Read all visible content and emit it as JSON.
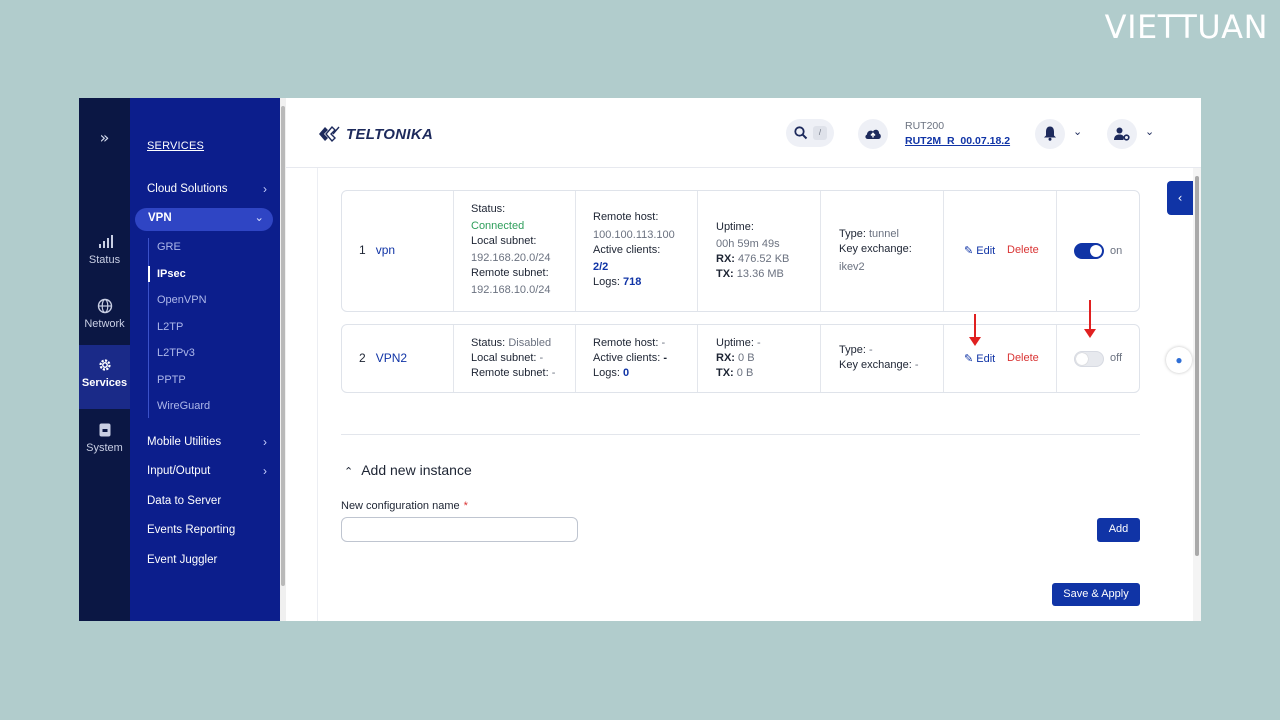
{
  "watermark": "VIETTUAN",
  "rail": {
    "toggle_icon": "double-chevron-right-icon",
    "items": [
      {
        "label": "Status",
        "icon": "signal-bars-icon"
      },
      {
        "label": "Network",
        "icon": "globe-icon"
      },
      {
        "label": "Services",
        "icon": "gear-icon",
        "active": true
      },
      {
        "label": "System",
        "icon": "system-icon"
      }
    ]
  },
  "sidebar": {
    "title": "SERVICES",
    "top_items": [
      "Cloud Solutions"
    ],
    "vpn_label": "VPN",
    "vpn_sub": [
      "GRE",
      "IPsec",
      "OpenVPN",
      "L2TP",
      "L2TPv3",
      "PPTP",
      "WireGuard"
    ],
    "vpn_active": "IPsec",
    "bottom_items": [
      "Mobile Utilities",
      "Input/Output",
      "Data to Server",
      "Events Reporting",
      "Event Juggler"
    ]
  },
  "header": {
    "logo_text": "TELTONIKA",
    "search_key": "/",
    "device_model": "RUT200",
    "firmware": "RUT2M_R_00.07.18.2"
  },
  "instances": [
    {
      "index": "1",
      "name": "vpn",
      "status_label": "Status:",
      "status": "Connected",
      "local_subnet_label": "Local subnet:",
      "local_subnet": "192.168.20.0/24",
      "remote_subnet_label": "Remote subnet:",
      "remote_subnet": "192.168.10.0/24",
      "remote_host_label": "Remote host:",
      "remote_host": "100.100.113.100",
      "active_clients_label": "Active clients:",
      "active_clients": "2/2",
      "logs_label": "Logs:",
      "logs": "718",
      "uptime_label": "Uptime:",
      "uptime": "00h 59m 49s",
      "rx_label": "RX:",
      "rx": "476.52 KB",
      "tx_label": "TX:",
      "tx": "13.36 MB",
      "type_label": "Type:",
      "type": "tunnel",
      "key_exchange_label": "Key exchange:",
      "key_exchange": "ikev2",
      "edit_label": "Edit",
      "delete_label": "Delete",
      "enabled": true,
      "toggle_label": "on"
    },
    {
      "index": "2",
      "name": "VPN2",
      "status_label": "Status:",
      "status": "Disabled",
      "local_subnet_label": "Local subnet:",
      "local_subnet": "-",
      "remote_subnet_label": "Remote subnet:",
      "remote_subnet": "-",
      "remote_host_label": "Remote host:",
      "remote_host": "-",
      "active_clients_label": "Active clients:",
      "active_clients": "-",
      "logs_label": "Logs:",
      "logs": "0",
      "uptime_label": "Uptime:",
      "uptime": "-",
      "rx_label": "RX:",
      "rx": "0 B",
      "tx_label": "TX:",
      "tx": "0 B",
      "type_label": "Type:",
      "type": "-",
      "key_exchange_label": "Key exchange:",
      "key_exchange": "-",
      "edit_label": "Edit",
      "delete_label": "Delete",
      "enabled": false,
      "toggle_label": "off"
    }
  ],
  "add_instance": {
    "title": "Add new instance",
    "field_label": "New configuration name",
    "required_mark": "*",
    "input_value": "",
    "add_label": "Add"
  },
  "save_apply_label": "Save & Apply",
  "colors": {
    "accent": "#1034a6",
    "sidebar": "#0c1e8c",
    "rail": "#0b1744",
    "connected": "#2e9e5b",
    "delete": "#d93434",
    "annotation_arrow": "#e02020",
    "background": "#b1cccc"
  }
}
